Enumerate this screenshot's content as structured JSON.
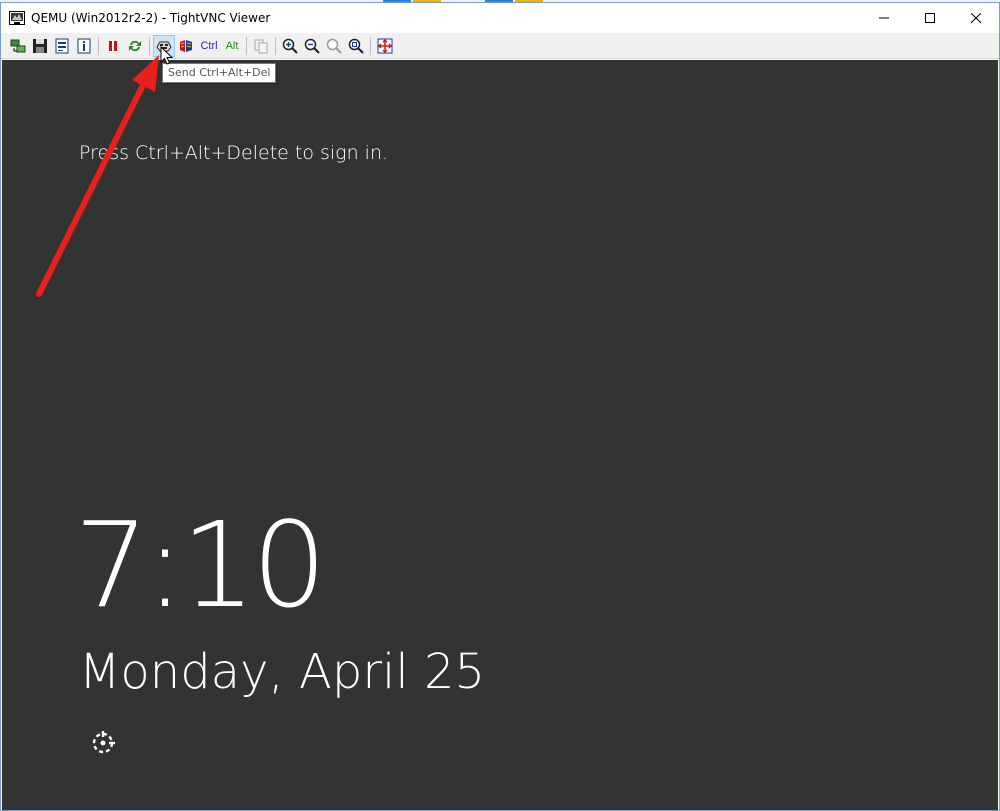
{
  "window": {
    "title": "QEMU (Win2012r2-2) - TightVNC Viewer",
    "controls": [
      "minimize-icon",
      "maximize-icon",
      "close-icon"
    ]
  },
  "toolbar": {
    "buttons": [
      {
        "name": "new-connection",
        "icon": "new-connection-icon"
      },
      {
        "name": "save-session",
        "icon": "floppy-icon"
      },
      {
        "name": "options",
        "icon": "options-icon"
      },
      {
        "name": "connection-info",
        "icon": "info-icon"
      },
      {
        "name": "pause",
        "icon": "pause-icon"
      },
      {
        "name": "refresh",
        "icon": "refresh-icon"
      },
      {
        "name": "send-ctrl-alt-del",
        "icon": "ctrl-alt-del-icon",
        "active": true
      },
      {
        "name": "send-ctrl-esc",
        "icon": "ctrl-esc-icon"
      },
      {
        "name": "ctrl-toggle",
        "label": "Ctrl"
      },
      {
        "name": "alt-toggle",
        "label": "Alt"
      },
      {
        "name": "transfer-files",
        "icon": "files-icon"
      },
      {
        "name": "zoom-in",
        "icon": "zoom-in-icon"
      },
      {
        "name": "zoom-out",
        "icon": "zoom-out-icon"
      },
      {
        "name": "zoom-100",
        "icon": "zoom-100-icon"
      },
      {
        "name": "zoom-auto",
        "icon": "zoom-fit-icon"
      },
      {
        "name": "full-screen",
        "icon": "full-screen-icon"
      }
    ],
    "ctrl_label": "Ctrl",
    "alt_label": "Alt",
    "ctrl_color": "#2a2aa8",
    "alt_color": "#2a8a2a"
  },
  "tooltip": {
    "text": "Send Ctrl+Alt+Del"
  },
  "lock_screen": {
    "hint": "Press Ctrl+Alt+Delete to sign in.",
    "time": "7:10",
    "date": "Monday, April 25",
    "ease_of_access_icon": "ease-of-access-icon",
    "background": "#333333"
  },
  "annotation": {
    "arrow_color": "#e8201c"
  }
}
